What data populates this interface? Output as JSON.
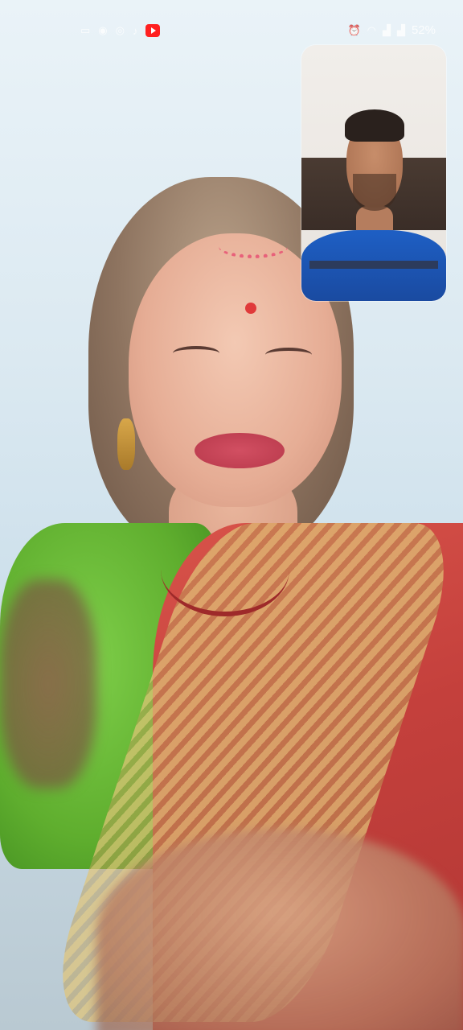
{
  "status_bar": {
    "left_icons": [
      "notification-icon",
      "notification-icon",
      "notification-icon",
      "tiktok-icon",
      "youtube-icon"
    ],
    "right_icons": [
      "alarm-icon",
      "wifi-icon",
      "signal-icon",
      "signal-icon"
    ],
    "battery": "52%"
  },
  "call": {
    "remote_video": "remote-video-feed",
    "self_preview": "self-preview-feed"
  }
}
